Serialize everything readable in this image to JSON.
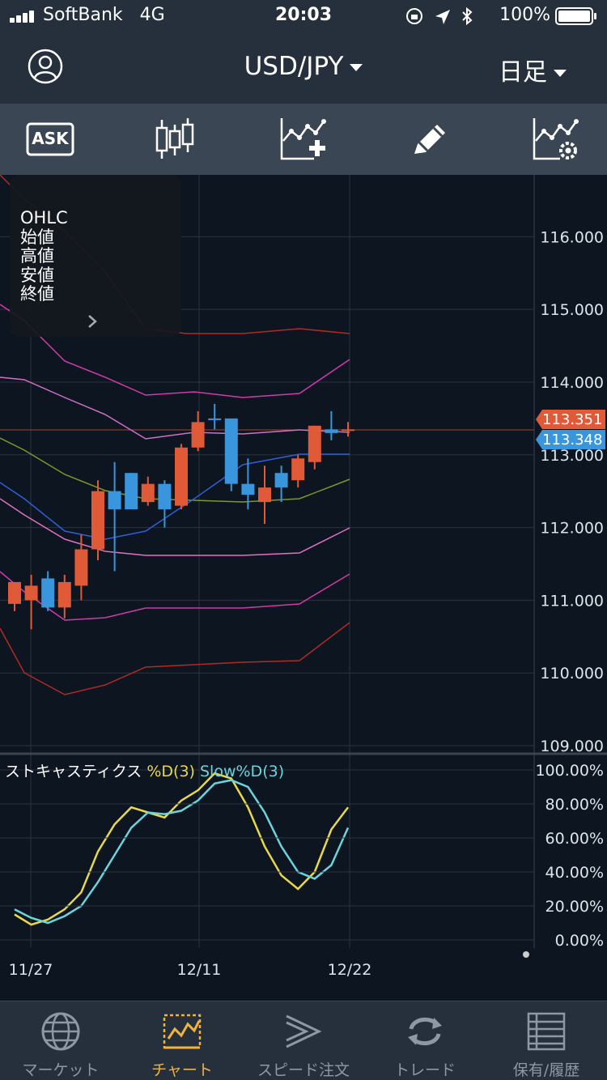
{
  "status_bar": {
    "carrier": "SoftBank",
    "network": "4G",
    "time": "20:03",
    "battery": "100%"
  },
  "header": {
    "pair": "USD/JPY",
    "period": "日足",
    "account_icon": "account-circle-icon"
  },
  "toolbar": {
    "items": [
      {
        "name": "ask-button",
        "label": "ASK"
      },
      {
        "name": "candlestick-icon"
      },
      {
        "name": "add-indicator-icon"
      },
      {
        "name": "draw-pencil-icon"
      },
      {
        "name": "indicator-settings-icon"
      }
    ]
  },
  "ohlc_panel": {
    "title": "OHLC",
    "open": "始値",
    "high": "高値",
    "low": "安値",
    "close": "終値"
  },
  "price_axis": {
    "labels": [
      "116.000",
      "115.000",
      "114.000",
      "113.000",
      "112.000",
      "111.000",
      "110.000",
      "109.000"
    ]
  },
  "price_tags": {
    "bid": "113.351",
    "ask": "113.348"
  },
  "stoch": {
    "title": "ストキャスティクス",
    "d_label": "%D(3)",
    "slow_label": "Slow%D(3)",
    "axis": [
      "100.00%",
      "80.00%",
      "60.00%",
      "40.00%",
      "20.00%",
      "0.00%"
    ]
  },
  "date_axis": [
    "11/27",
    "12/11",
    "12/22"
  ],
  "colors": {
    "up": "#e05a38",
    "down": "#3a96dc",
    "bid_tag": "#e05a38",
    "ask_tag": "#3a96dc",
    "d_line": "#e8d84a",
    "slow_line": "#6cd4dc",
    "active_tab": "#f0b43c"
  },
  "chart_data": {
    "type": "candlestick",
    "ylim": [
      109,
      116.5
    ],
    "candles": [
      {
        "o": 110.95,
        "h": 111.15,
        "l": 110.85,
        "c": 111.25
      },
      {
        "o": 111.0,
        "h": 111.35,
        "l": 110.6,
        "c": 111.2,
        "dir": "up"
      },
      {
        "o": 111.3,
        "h": 111.4,
        "l": 110.85,
        "c": 110.9,
        "dir": "down"
      },
      {
        "o": 110.9,
        "h": 111.35,
        "l": 110.75,
        "c": 111.25,
        "dir": "up"
      },
      {
        "o": 111.2,
        "h": 111.9,
        "l": 111.0,
        "c": 111.7,
        "dir": "up"
      },
      {
        "o": 111.7,
        "h": 112.65,
        "l": 111.55,
        "c": 112.5,
        "dir": "up"
      },
      {
        "o": 112.5,
        "h": 112.9,
        "l": 111.4,
        "c": 112.25,
        "dir": "down"
      },
      {
        "o": 112.25,
        "h": 112.6,
        "l": 112.35,
        "c": 112.75,
        "dir": "down"
      },
      {
        "o": 112.35,
        "h": 112.7,
        "l": 112.3,
        "c": 112.6,
        "dir": "up"
      },
      {
        "o": 112.6,
        "h": 112.65,
        "l": 112.0,
        "c": 112.25,
        "dir": "down"
      },
      {
        "o": 112.3,
        "h": 113.15,
        "l": 112.25,
        "c": 113.1,
        "dir": "up"
      },
      {
        "o": 113.1,
        "h": 113.6,
        "l": 113.05,
        "c": 113.45,
        "dir": "up"
      },
      {
        "o": 113.5,
        "h": 113.7,
        "l": 113.35,
        "c": 113.5,
        "dir": "down"
      },
      {
        "o": 113.5,
        "h": 113.5,
        "l": 112.5,
        "c": 112.6,
        "dir": "down"
      },
      {
        "o": 112.6,
        "h": 112.95,
        "l": 112.25,
        "c": 112.45,
        "dir": "down"
      },
      {
        "o": 112.35,
        "h": 112.85,
        "l": 112.05,
        "c": 112.55,
        "dir": "up"
      },
      {
        "o": 112.55,
        "h": 112.85,
        "l": 112.35,
        "c": 112.75,
        "dir": "down"
      },
      {
        "o": 112.65,
        "h": 113.0,
        "l": 112.55,
        "c": 112.95,
        "dir": "up"
      },
      {
        "o": 112.9,
        "h": 113.4,
        "l": 112.8,
        "c": 113.4,
        "dir": "up"
      },
      {
        "o": 113.3,
        "h": 113.6,
        "l": 113.2,
        "c": 113.35,
        "dir": "down"
      },
      {
        "o": 113.35,
        "h": 113.45,
        "l": 113.25,
        "c": 113.35,
        "dir": "up"
      }
    ],
    "stochastic_d": [
      15,
      9,
      12,
      18,
      28,
      52,
      68,
      78,
      75,
      72,
      82,
      88,
      98,
      95,
      78,
      55,
      38,
      30,
      40,
      65,
      78
    ],
    "stochastic_slow": [
      18,
      13,
      10,
      14,
      20,
      34,
      50,
      66,
      75,
      74,
      76,
      82,
      92,
      94,
      90,
      75,
      55,
      40,
      36,
      44,
      66
    ]
  },
  "tabs": [
    {
      "name": "market",
      "label": "マーケット"
    },
    {
      "name": "chart",
      "label": "チャート"
    },
    {
      "name": "speed-order",
      "label": "スピード注文"
    },
    {
      "name": "trade",
      "label": "トレード"
    },
    {
      "name": "history",
      "label": "保有/履歴"
    }
  ]
}
